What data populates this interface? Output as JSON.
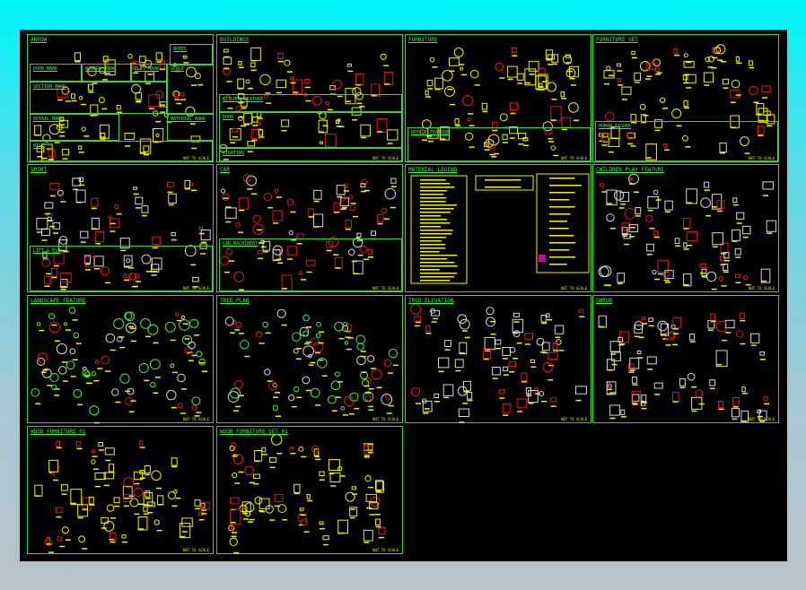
{
  "drawing": {
    "panels": [
      {
        "title": "ARROW",
        "footer": "NOT TO SCALE",
        "scheme": "yellow",
        "subs": [
          "NOTES",
          "DOOR MARK",
          "WINDOW MARK",
          "ELEV MARK",
          "SCALE",
          "SECTION MARK",
          "DETAIL MARK",
          "MATERIAL MARK",
          "MISC"
        ]
      },
      {
        "title": "BUILDINGS",
        "footer": "NOT TO SCALE",
        "scheme": "yellowred",
        "subs": [
          "KITCHEN FEATURE",
          "DOOR",
          "LIGHTING"
        ]
      },
      {
        "title": "FURNITURE",
        "footer": "NOT TO SCALE",
        "scheme": "yellow",
        "subs": [
          "OFFICE FEATURE"
        ]
      },
      {
        "title": "FURNITURE SET",
        "footer": "NOT TO SCALE",
        "scheme": "yellowred",
        "subs": [
          "HUMAN FIGURE"
        ]
      },
      {
        "title": "SPORT",
        "footer": "NOT TO SCALE",
        "scheme": "white",
        "subs": [
          "LIFT & ESC"
        ]
      },
      {
        "title": "CAR",
        "footer": "NOT TO SCALE",
        "scheme": "red",
        "subs": [
          "CAR MACHINERY"
        ]
      },
      {
        "title": "MATERIAL LEGEND",
        "footer": "NOT TO SCALE",
        "scheme": "legend",
        "subs": []
      },
      {
        "title": "CHILDREN PLAY FEATURE",
        "footer": "NOT TO SCALE",
        "scheme": "white",
        "subs": []
      },
      {
        "title": "LANDSCAPE FEATURE",
        "footer": "NOT TO SCALE",
        "scheme": "green",
        "subs": []
      },
      {
        "title": "TREE PLAN",
        "footer": "NOT TO SCALE",
        "scheme": "green",
        "subs": []
      },
      {
        "title": "TREE ELEVATION",
        "footer": "NOT TO SCALE",
        "scheme": "white",
        "subs": []
      },
      {
        "title": "SHRUB",
        "footer": "NOT TO SCALE",
        "scheme": "white",
        "subs": []
      },
      {
        "title": "WOOD FURNITURE 01",
        "footer": "NOT TO SCALE",
        "scheme": "yellow",
        "subs": []
      },
      {
        "title": "WOOD FURNITURE SET 01",
        "footer": "NOT TO SCALE",
        "scheme": "yellow",
        "subs": []
      }
    ],
    "colors": {
      "frame": "#3ad23a",
      "yellow": "#f0f000",
      "red": "#e01818",
      "green": "#3ef23e",
      "white": "#d8d8d8",
      "magenta": "#c000c0"
    }
  }
}
